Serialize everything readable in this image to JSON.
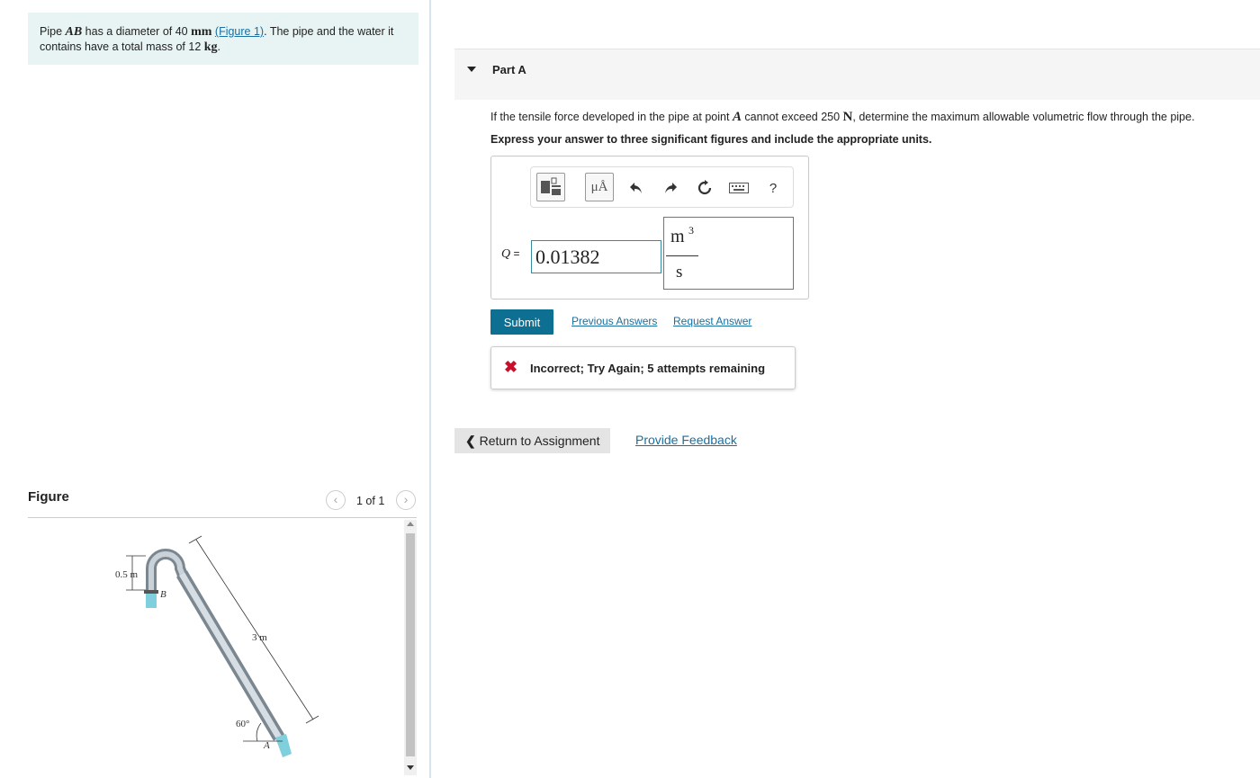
{
  "problem": {
    "text_1": "Pipe ",
    "pipe_name": "AB",
    "text_2": " has a diameter of 40 ",
    "diameter_unit": "mm",
    "figure_link": "(Figure 1)",
    "text_3": ". The pipe and the water it contains have a total mass of 12 ",
    "mass_unit": "kg",
    "text_4": "."
  },
  "part_a": {
    "title": "Part A",
    "question_1": "If the tensile force developed in the pipe at point ",
    "point": "A",
    "question_2": " cannot exceed 250 ",
    "force_unit": "N",
    "question_3": ", determine the maximum allowable volumetric flow through the pipe.",
    "instructions": "Express your answer to three significant figures and include the appropriate units."
  },
  "toolbar": {
    "templates_icon": "templates-icon",
    "units_label": "μÅ",
    "undo_icon": "undo-icon",
    "redo_icon": "redo-icon",
    "reset_icon": "reset-icon",
    "keyboard_icon": "keyboard-icon",
    "help_label": "?"
  },
  "answer": {
    "label": "Q =",
    "value": "0.01382",
    "unit_numerator": "m",
    "unit_exponent": "3",
    "unit_denominator": "s"
  },
  "actions": {
    "submit_label": "Submit",
    "previous_answers": "Previous Answers",
    "request_answer": "Request Answer"
  },
  "feedback": {
    "icon": "x-icon",
    "message": "Incorrect; Try Again; 5 attempts remaining"
  },
  "nav": {
    "return_label": "Return to Assignment",
    "provide_feedback": "Provide Feedback"
  },
  "figure": {
    "title": "Figure",
    "pager": "1 of 1",
    "labels": {
      "height": "0.5 m",
      "point_b": "B",
      "length": "3 m",
      "angle": "60°",
      "point_a": "A"
    }
  },
  "colors": {
    "accent": "#0d6f91",
    "problem_bg": "#e8f4f4",
    "error": "#c8102e"
  }
}
